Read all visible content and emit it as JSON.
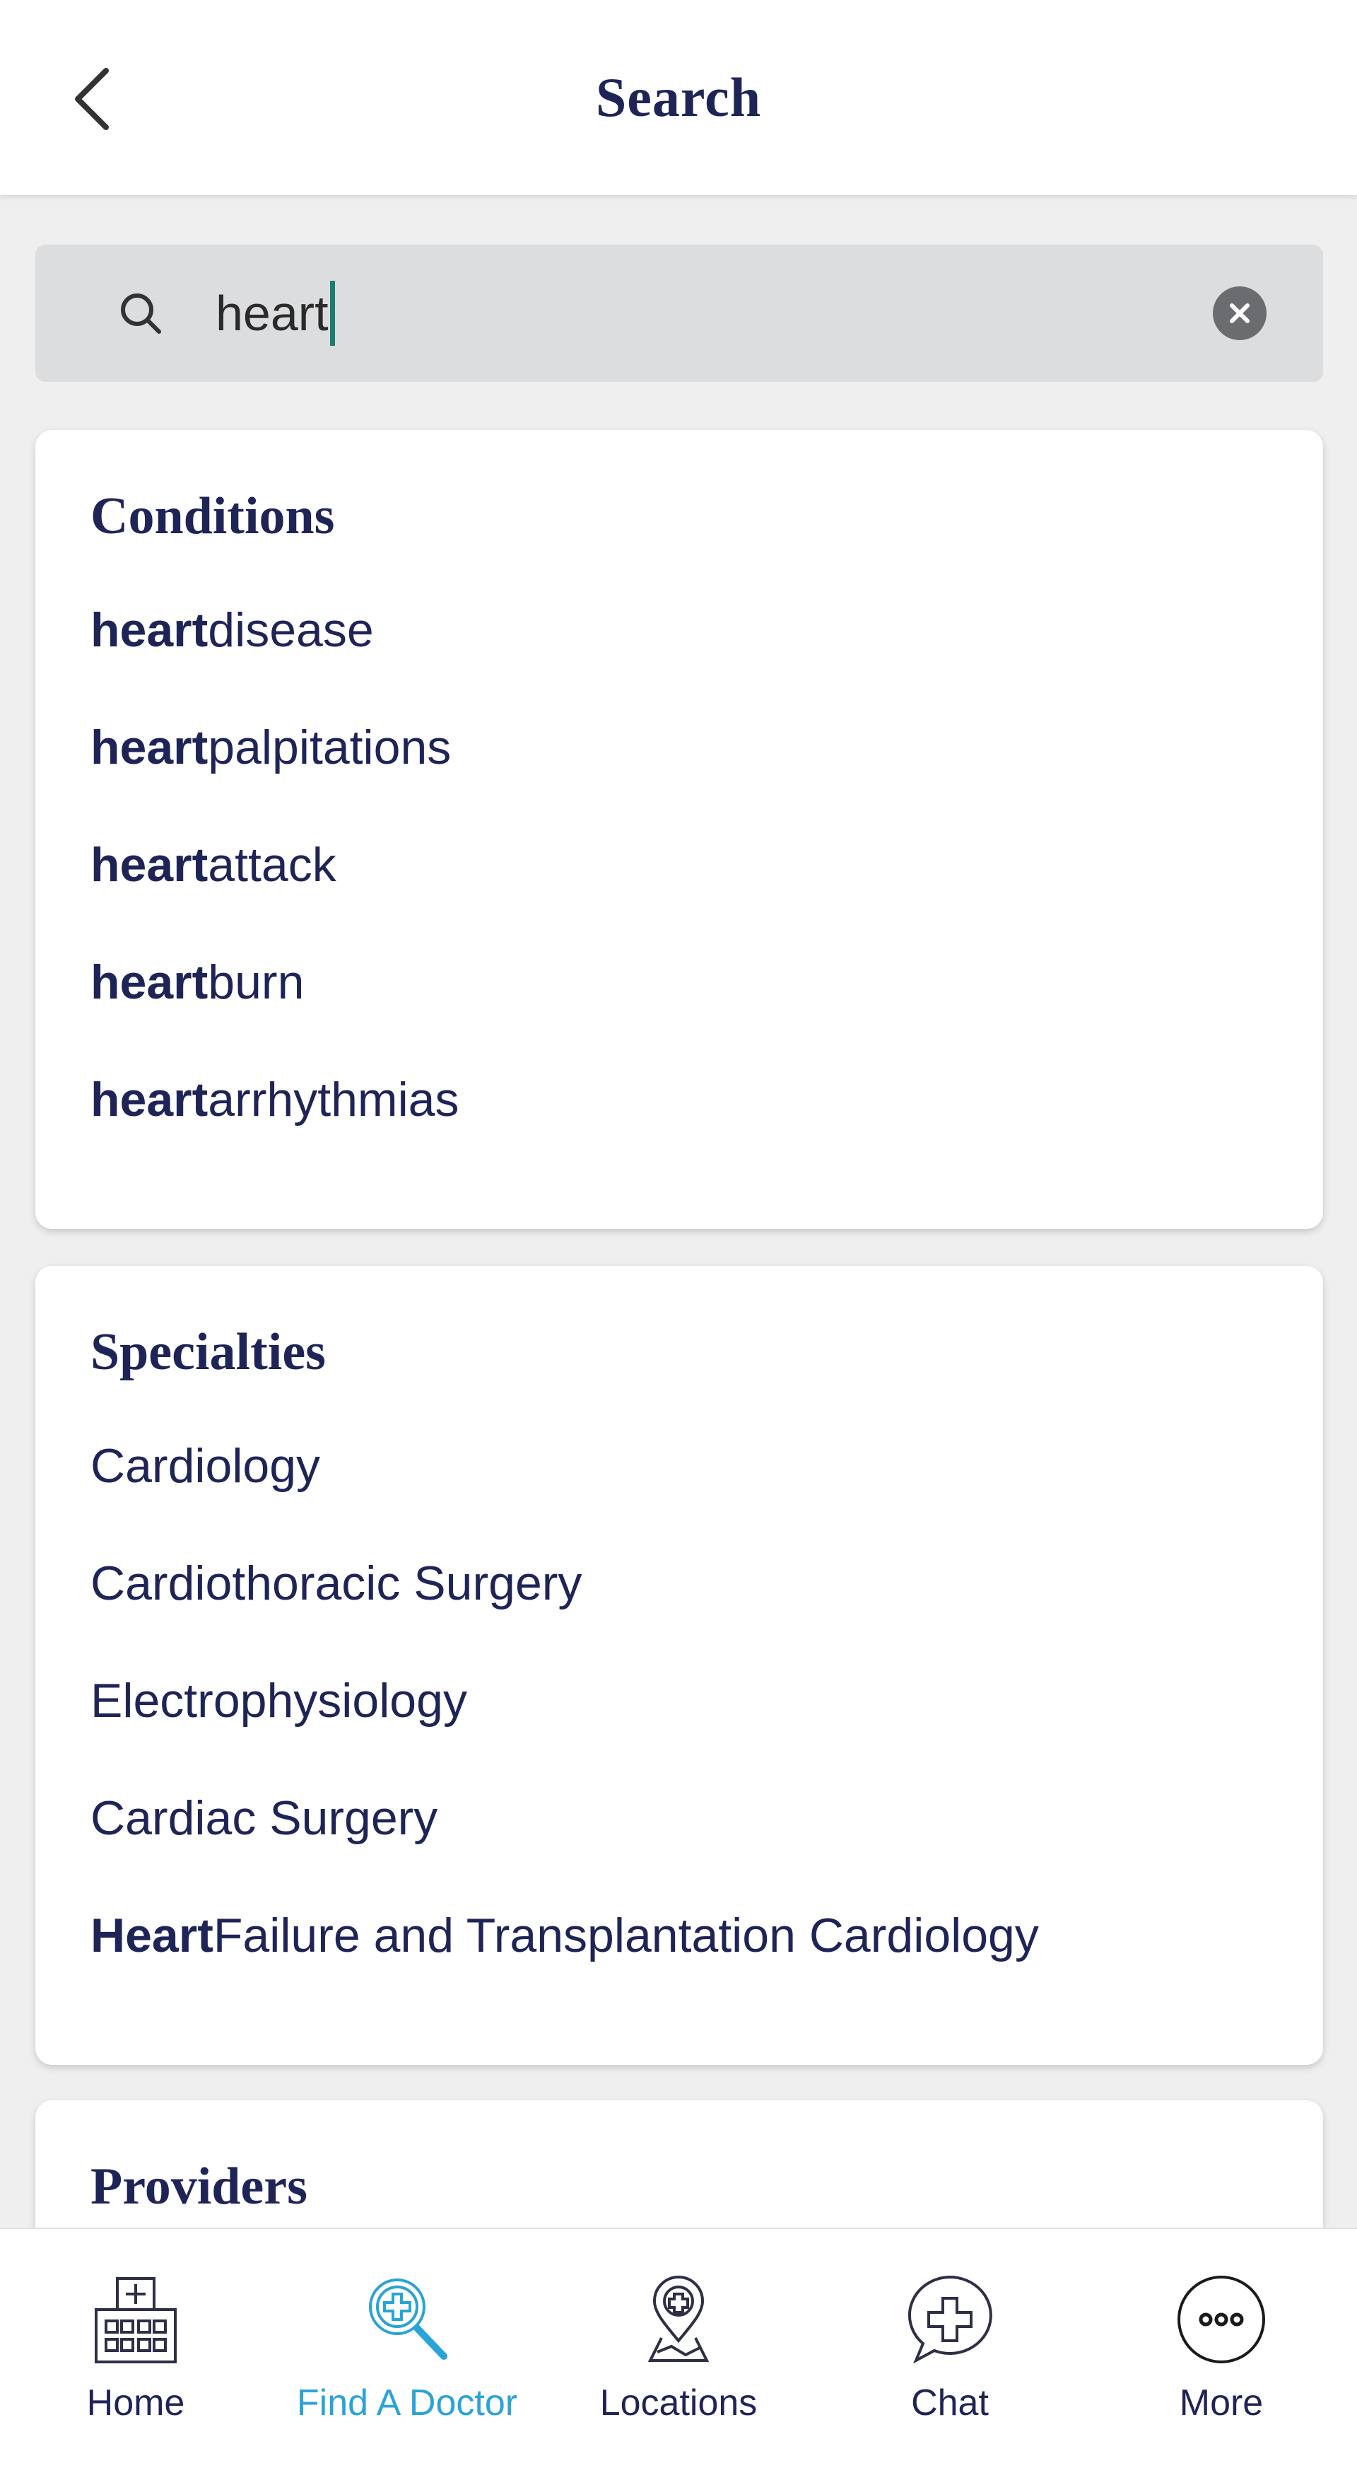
{
  "header": {
    "title": "Search"
  },
  "search": {
    "value": "heart"
  },
  "conditions": {
    "heading": "Conditions",
    "items": [
      {
        "bold": "heart",
        "rest": " disease"
      },
      {
        "bold": "heart",
        "rest": " palpitations"
      },
      {
        "bold": "heart",
        "rest": " attack"
      },
      {
        "bold": "heart",
        "rest": "burn"
      },
      {
        "bold": "heart",
        "rest": " arrhythmias"
      }
    ]
  },
  "specialties": {
    "heading": "Specialties",
    "items": [
      {
        "bold": "",
        "rest": "Cardiology"
      },
      {
        "bold": "",
        "rest": "Cardiothoracic Surgery"
      },
      {
        "bold": "",
        "rest": "Electrophysiology"
      },
      {
        "bold": "",
        "rest": "Cardiac Surgery"
      },
      {
        "bold": "Heart",
        "rest": " Failure and Transplantation Cardiology"
      }
    ]
  },
  "providers": {
    "heading": "Providers"
  },
  "bottom_nav": {
    "items": [
      {
        "label": "Home",
        "icon": "hospital-icon",
        "active": false
      },
      {
        "label": "Find A Doctor",
        "icon": "find-doctor-icon",
        "active": true
      },
      {
        "label": "Locations",
        "icon": "location-pin-icon",
        "active": false
      },
      {
        "label": "Chat",
        "icon": "chat-icon",
        "active": false
      },
      {
        "label": "More",
        "icon": "more-icon",
        "active": false
      }
    ]
  },
  "colors": {
    "primary_text": "#1f2457",
    "accent_active": "#2aa3d6",
    "caret": "#1a7f72",
    "search_bg": "#dcdddf",
    "page_bg": "#efefef"
  }
}
